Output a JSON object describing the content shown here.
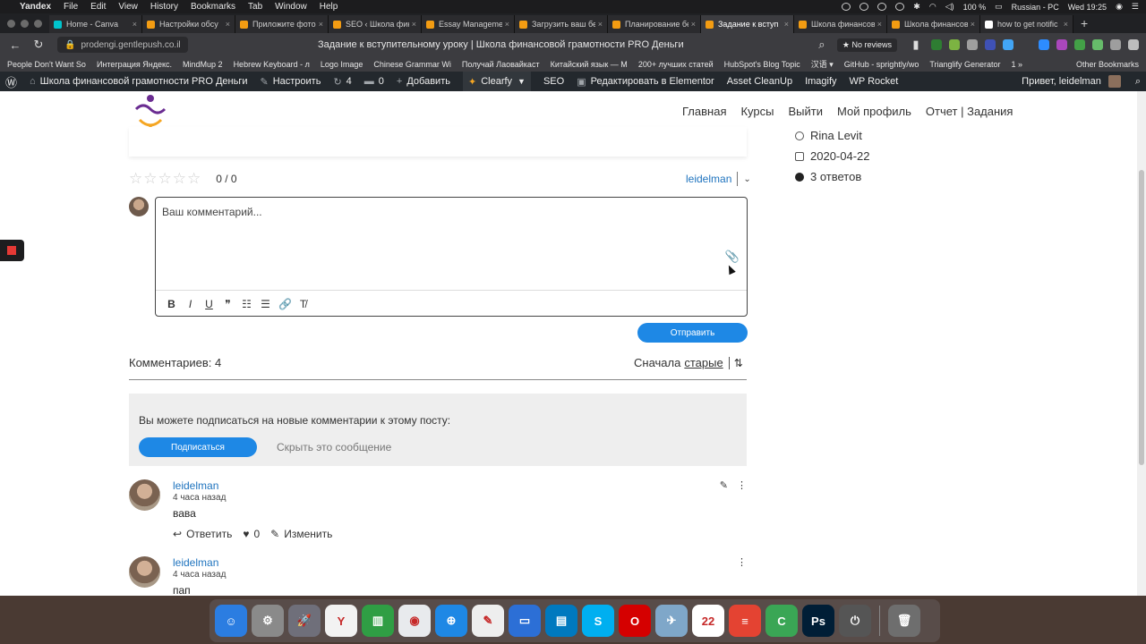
{
  "menubar": {
    "app": "Yandex",
    "items": [
      "File",
      "Edit",
      "View",
      "History",
      "Bookmarks",
      "Tab",
      "Window",
      "Help"
    ],
    "battery": "100 %",
    "input": "Russian - PC",
    "clock": "Wed 19:25"
  },
  "tabs": [
    {
      "title": "Home - Canva",
      "color": "#00c4cc"
    },
    {
      "title": "Настройки обсу",
      "color": "#f39c12"
    },
    {
      "title": "Приложите фото",
      "color": "#f39c12"
    },
    {
      "title": "SEO ‹ Школа фин",
      "color": "#f39c12"
    },
    {
      "title": "Essay Manageme",
      "color": "#f39c12"
    },
    {
      "title": "Загрузить ваш бе",
      "color": "#f39c12"
    },
    {
      "title": "Планирование бе",
      "color": "#f39c12"
    },
    {
      "title": "Задание к вступ",
      "color": "#f39c12",
      "active": true
    },
    {
      "title": "Школа финансов",
      "color": "#f39c12"
    },
    {
      "title": "Школа финансов",
      "color": "#f39c12"
    },
    {
      "title": "how to get notific",
      "color": "#ffffff"
    }
  ],
  "address": {
    "url": "prodengi.gentlepush.co.il",
    "title": "Задание к вступительному уроку | Школа финансовой грамотности PRO Деньги",
    "reviews": "★ No reviews"
  },
  "bookmarks": [
    "People Don't Want So",
    "Интеграция Яндекс.",
    "MindMup 2",
    "Hebrew Keyboard - л",
    "Logo Image",
    "Chinese Grammar Wi",
    "Получай Лаовайкаст",
    "Китайский язык — М",
    "200+ лучших статей",
    "HubSpot's Blog Topic",
    "汉语 ▾",
    "GitHub - sprightly/wo",
    "Trianglify Generator",
    "1 »"
  ],
  "bookmarks_other": "Other Bookmarks",
  "wpbar": {
    "site": "Школа финансовой грамотности PRO Деньги",
    "customize": "Настроить",
    "updates": "4",
    "comments": "0",
    "add": "Добавить",
    "clearfy": "Clearfy",
    "seo": "SEO",
    "elementor": "Редактировать в Elementor",
    "cleanup": "Asset CleanUp",
    "imagify": "Imagify",
    "rocket": "WP Rocket",
    "greeting": "Привет, leidelman"
  },
  "site": {
    "nav": [
      "Главная",
      "Курсы",
      "Выйти",
      "Мой профиль",
      "Отчет | Задания"
    ],
    "meta": {
      "author": "Rina Levit",
      "date": "2020-04-22",
      "answers": "3 ответов"
    },
    "rating": {
      "score": "0 / 0",
      "stars": "☆☆☆☆☆"
    },
    "user": "leidelman",
    "editor": {
      "placeholder": "Ваш комментарий..."
    },
    "send": "Отправить",
    "count": "Комментариев: 4",
    "sort_prefix": "Сначала",
    "sort_link": "старые",
    "subscribe": {
      "text": "Вы можете подписаться на новые комментарии к этому посту:",
      "button": "Подписаться",
      "hide": "Скрыть это сообщение"
    },
    "comments": [
      {
        "author": "leidelman",
        "time": "4 часа назад",
        "text": "вава",
        "reply": "Ответить",
        "likes": "0",
        "edit": "Изменить"
      },
      {
        "author": "leidelman",
        "time": "4 часа назад",
        "text": "пап"
      }
    ]
  },
  "dock": [
    {
      "name": "Finder",
      "color": "#2b7de1",
      "glyph": "☺"
    },
    {
      "name": "System Preferences",
      "color": "#8a8a8a",
      "glyph": "⚙"
    },
    {
      "name": "Launchpad",
      "color": "#6f6f7a",
      "glyph": "🚀"
    },
    {
      "name": "Yandex",
      "color": "#f2f2f2",
      "glyph": "Y"
    },
    {
      "name": "Numbers",
      "color": "#2f9e44",
      "glyph": "▥"
    },
    {
      "name": "Chrome",
      "color": "#e8eaed",
      "glyph": "◉"
    },
    {
      "name": "Safari",
      "color": "#1e88e5",
      "glyph": "⊕"
    },
    {
      "name": "TextEdit",
      "color": "#eeeeee",
      "glyph": "✎"
    },
    {
      "name": "Keynote",
      "color": "#2c6fd6",
      "glyph": "▭"
    },
    {
      "name": "Trello",
      "color": "#0079bf",
      "glyph": "▤"
    },
    {
      "name": "Skype",
      "color": "#00aff0",
      "glyph": "S"
    },
    {
      "name": "Opera",
      "color": "#d50000",
      "glyph": "O"
    },
    {
      "name": "Preview",
      "color": "#7fa7c9",
      "glyph": "✈"
    },
    {
      "name": "Calendar",
      "color": "#ffffff",
      "glyph": "22"
    },
    {
      "name": "Todoist",
      "color": "#e44332",
      "glyph": "≡"
    },
    {
      "name": "Coda",
      "color": "#3aa655",
      "glyph": "C"
    },
    {
      "name": "Photoshop",
      "color": "#001e36",
      "glyph": "Ps"
    },
    {
      "name": "Power",
      "color": "#555555",
      "glyph": "⏻"
    },
    {
      "name": "Trash",
      "color": "#6e6e6e",
      "glyph": "🗑"
    }
  ]
}
